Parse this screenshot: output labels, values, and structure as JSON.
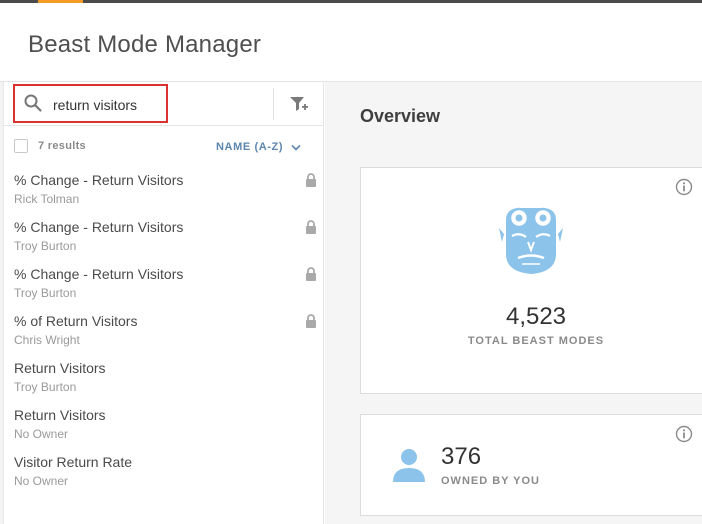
{
  "app": {
    "title": "Beast Mode Manager",
    "accent_color": "#f59a23"
  },
  "search": {
    "value": "return visitors",
    "icon": "search-icon",
    "highlight_color": "#d9322f"
  },
  "filter": {
    "icon": "filter-add-icon"
  },
  "results": {
    "count_label": "7 results",
    "sort_label": "NAME (A-Z)",
    "sort_color": "#5c86ad"
  },
  "list": {
    "items": [
      {
        "name": "% Change - Return Visitors",
        "owner": "Rick Tolman",
        "locked": true
      },
      {
        "name": "% Change - Return Visitors",
        "owner": "Troy Burton",
        "locked": true
      },
      {
        "name": "% Change - Return Visitors",
        "owner": "Troy Burton",
        "locked": true
      },
      {
        "name": "% of Return Visitors",
        "owner": "Chris Wright",
        "locked": true
      },
      {
        "name": "Return Visitors",
        "owner": "Troy Burton",
        "locked": false
      },
      {
        "name": "Return Visitors",
        "owner": "No Owner",
        "locked": false
      },
      {
        "name": "Visitor Return Rate",
        "owner": "No Owner",
        "locked": false
      }
    ]
  },
  "overview": {
    "title": "Overview",
    "total": {
      "value": "4,523",
      "caption": "TOTAL BEAST MODES",
      "icon": "beast-mascot-icon"
    },
    "owned": {
      "value": "376",
      "caption": "OWNED BY YOU",
      "icon": "user-icon"
    },
    "icon_color": "#8cc3ea"
  }
}
